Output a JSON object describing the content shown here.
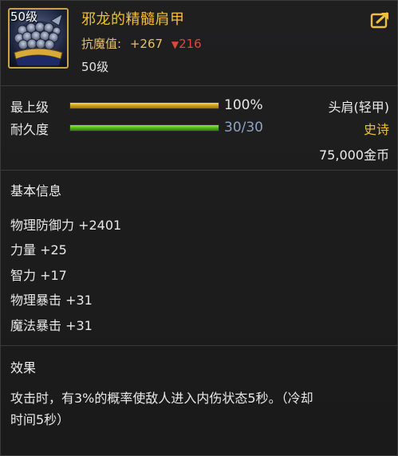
{
  "item": {
    "level_tag": "50级",
    "name": "邪龙的精髓肩甲",
    "attr_label": "抗魔值:",
    "attr_up": "+267",
    "attr_down": "216",
    "level_text": "50级"
  },
  "bars": {
    "max_level_label": "最上级",
    "max_level_value": "100%",
    "max_level_fill": 1.0,
    "durability_label": "耐久度",
    "durability_value": "30/30",
    "durability_fill": 1.0
  },
  "meta": {
    "slot": "头肩(轻甲)",
    "rarity": "史诗",
    "price": "75,000金币"
  },
  "basic": {
    "title": "基本信息",
    "stats": [
      "物理防御力 +2401",
      "力量 +25",
      "智力 +17",
      "物理暴击 +31",
      "魔法暴击 +31"
    ]
  },
  "effect": {
    "title": "效果",
    "line1": "攻击时，有3%的概率使敌人进入内伤状态5秒。（冷却",
    "line2": "时间5秒）"
  },
  "colors": {
    "name": "#f0bf3a",
    "rarity": "#f0bf3a",
    "bar_value_max": "#e8e8e8",
    "bar_value_durability": "#8fa3c4",
    "down": "#e0463a"
  },
  "icons": {
    "share": "share-icon",
    "item": "shoulder-armor-icon"
  }
}
